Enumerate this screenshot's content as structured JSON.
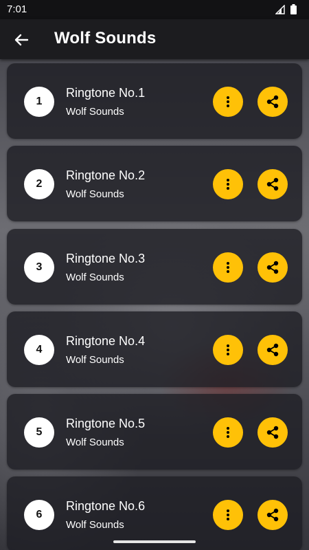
{
  "status": {
    "time": "7:01"
  },
  "appbar": {
    "title": "Wolf Sounds",
    "back_icon": "arrow-left-icon"
  },
  "ringtones": [
    {
      "number": "1",
      "name": "Ringtone No.1",
      "subtitle": "Wolf Sounds"
    },
    {
      "number": "2",
      "name": "Ringtone No.2",
      "subtitle": "Wolf Sounds"
    },
    {
      "number": "3",
      "name": "Ringtone No.3",
      "subtitle": "Wolf Sounds"
    },
    {
      "number": "4",
      "name": "Ringtone No.4",
      "subtitle": "Wolf Sounds"
    },
    {
      "number": "5",
      "name": "Ringtone No.5",
      "subtitle": "Wolf Sounds"
    },
    {
      "number": "6",
      "name": "Ringtone No.6",
      "subtitle": "Wolf Sounds"
    }
  ],
  "colors": {
    "accent": "#ffc107",
    "card": "#1e1e24",
    "appbar": "#1c1c1f"
  },
  "icons": {
    "more": "more-vertical-icon",
    "share": "share-icon"
  }
}
